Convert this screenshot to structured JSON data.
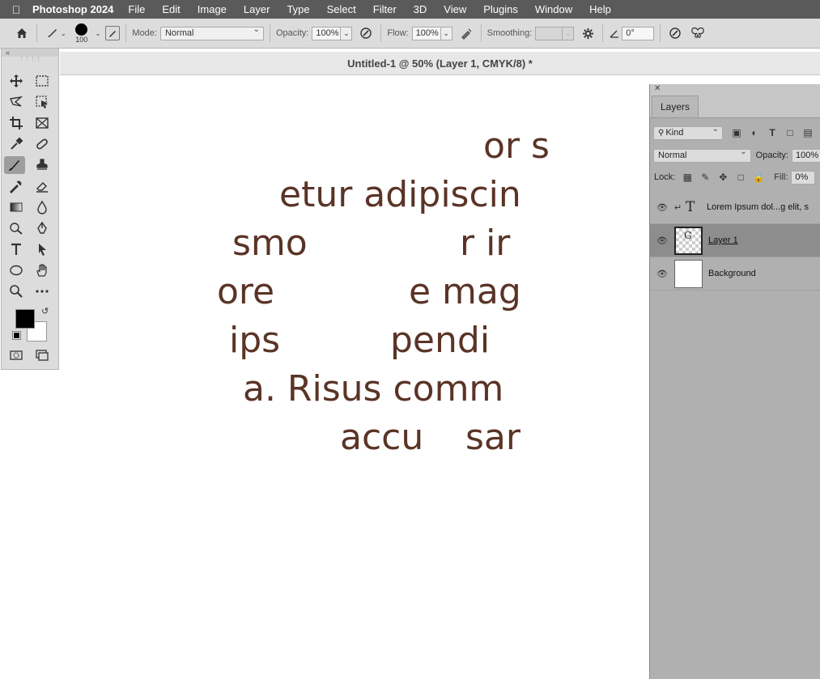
{
  "menubar": {
    "apple_icon": "apple-logo-icon",
    "app_name": "Photoshop 2024",
    "items": [
      "File",
      "Edit",
      "Image",
      "Layer",
      "Type",
      "Select",
      "Filter",
      "3D",
      "View",
      "Plugins",
      "Window",
      "Help"
    ]
  },
  "options_bar": {
    "brush_size": "100",
    "mode_label": "Mode:",
    "mode_value": "Normal",
    "opacity_label": "Opacity:",
    "opacity_value": "100%",
    "flow_label": "Flow:",
    "flow_value": "100%",
    "smoothing_label": "Smoothing:",
    "smoothing_value": "",
    "angle_value": "0°"
  },
  "document": {
    "tab_title": "Untitled-1 @ 50% (Layer 1, CMYK/8) *"
  },
  "canvas_text": {
    "color": "#5a3426",
    "lines": [
      "or s",
      "etur adipiscin",
      "smo",
      "r ir",
      "ore",
      "e mag",
      "ips",
      "pendi",
      "a. Risus comm",
      "accu",
      "sar"
    ]
  },
  "toolbox": {
    "foreground_color": "#000000",
    "background_color": "#ffffff"
  },
  "layers_panel": {
    "tab_label": "Layers",
    "filter_value": "Kind",
    "blend_mode": "Normal",
    "opacity_label": "Opacity:",
    "opacity_value": "100%",
    "lock_label": "Lock:",
    "fill_label": "Fill:",
    "fill_value": "0%",
    "layers": [
      {
        "name": "Lorem Ipsum dol...g elit, s",
        "type": "text",
        "clipped": true
      },
      {
        "name": "Layer 1",
        "type": "pixel",
        "selected": true,
        "thumb_glyph": "G"
      },
      {
        "name": "Background",
        "type": "background"
      }
    ]
  }
}
